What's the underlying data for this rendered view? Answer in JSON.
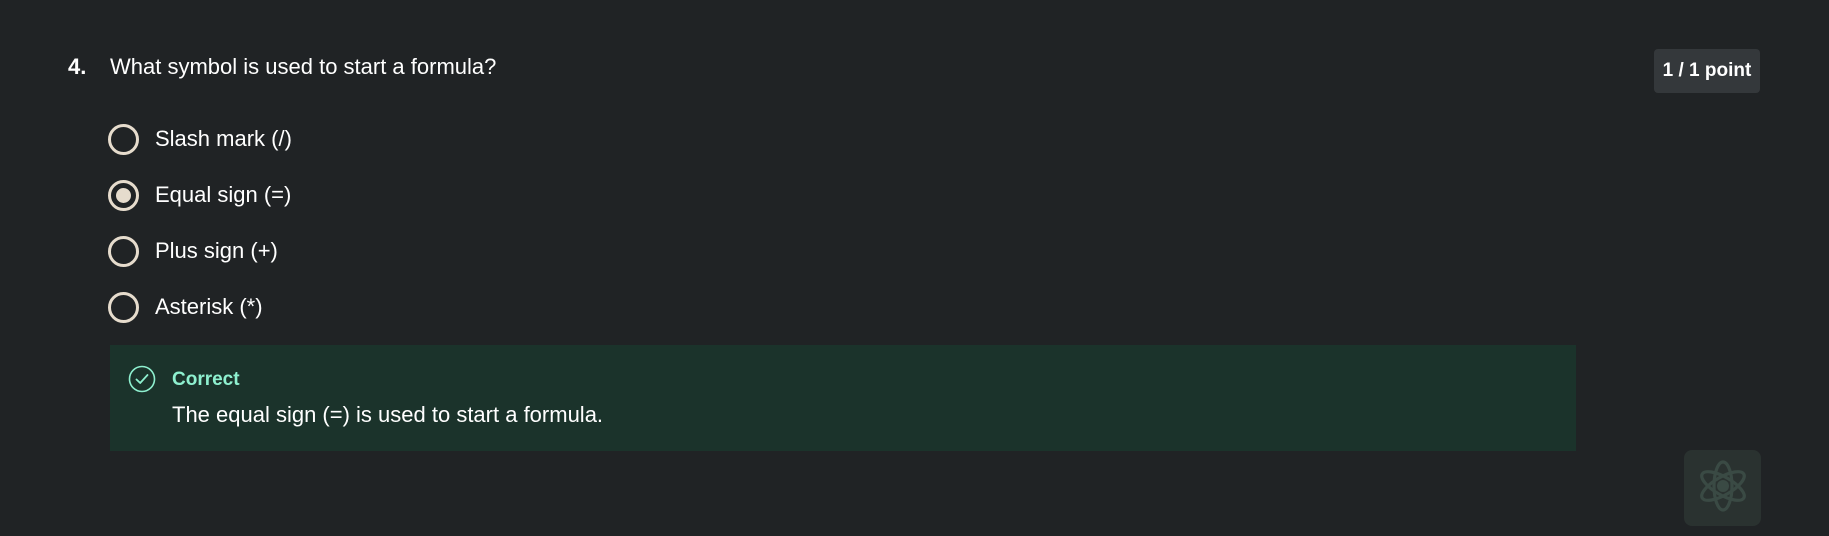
{
  "question": {
    "number": "4.",
    "text": "What symbol is used to start a formula?",
    "points": "1 / 1 point",
    "options": [
      {
        "label": "Slash mark (/)",
        "selected": false
      },
      {
        "label": "Equal sign (=)",
        "selected": true
      },
      {
        "label": "Plus sign (+)",
        "selected": false
      },
      {
        "label": "Asterisk (*)",
        "selected": false
      }
    ]
  },
  "feedback": {
    "status": "Correct",
    "message": "The equal sign (=) is used to start a formula.",
    "icon": "check-circle-icon"
  },
  "assistant": {
    "icon": "coach-logo-icon"
  },
  "colors": {
    "background": "#202325",
    "badge_background": "#34383b",
    "radio": "#e6dccd",
    "feedback_background": "#1b332b",
    "feedback_accent": "#8ef0cf"
  }
}
